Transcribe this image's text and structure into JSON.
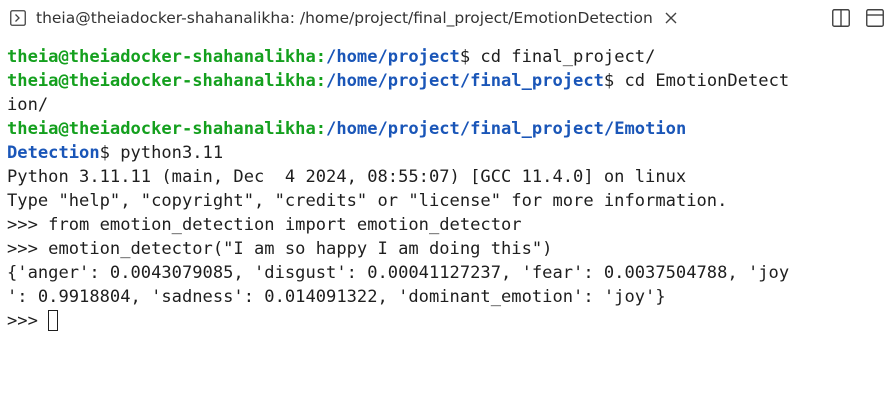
{
  "tab": {
    "title": "theia@theiadocker-shahanalikha: /home/project/final_project/EmotionDetection",
    "icon": "terminal-icon",
    "close_icon": "close-icon"
  },
  "toolbar": {
    "split_icon": "split-editor-icon",
    "maximize_icon": "maximize-panel-icon"
  },
  "colors": {
    "user": "#14a01e",
    "path": "#1a56b8",
    "text": "#1e1e1e"
  },
  "terminal": {
    "l1_user": "theia@theiadocker-shahanalikha",
    "l1_colon": ":",
    "l1_path": "/home/project",
    "l1_cmd": "$ cd final_project/",
    "l2_user": "theia@theiadocker-shahanalikha",
    "l2_colon": ":",
    "l2_path": "/home/project/final_project",
    "l2_cmd": "$ cd EmotionDetect",
    "l3": "ion/",
    "l4_user": "theia@theiadocker-shahanalikha",
    "l4_colon": ":",
    "l4_path": "/home/project/final_project/Emotion",
    "l5_path": "Detection",
    "l5_cmd": "$ python3.11",
    "l6": "Python 3.11.11 (main, Dec  4 2024, 08:55:07) [GCC 11.4.0] on linux",
    "l7": "Type \"help\", \"copyright\", \"credits\" or \"license\" for more information.",
    "l8": ">>> from emotion_detection import emotion_detector",
    "l9": ">>> emotion_detector(\"I am so happy I am doing this\")",
    "l10": "{'anger': 0.0043079085, 'disgust': 0.00041127237, 'fear': 0.0037504788, 'joy",
    "l11": "': 0.9918804, 'sadness': 0.014091322, 'dominant_emotion': 'joy'}",
    "l12_prompt": ">>> "
  }
}
